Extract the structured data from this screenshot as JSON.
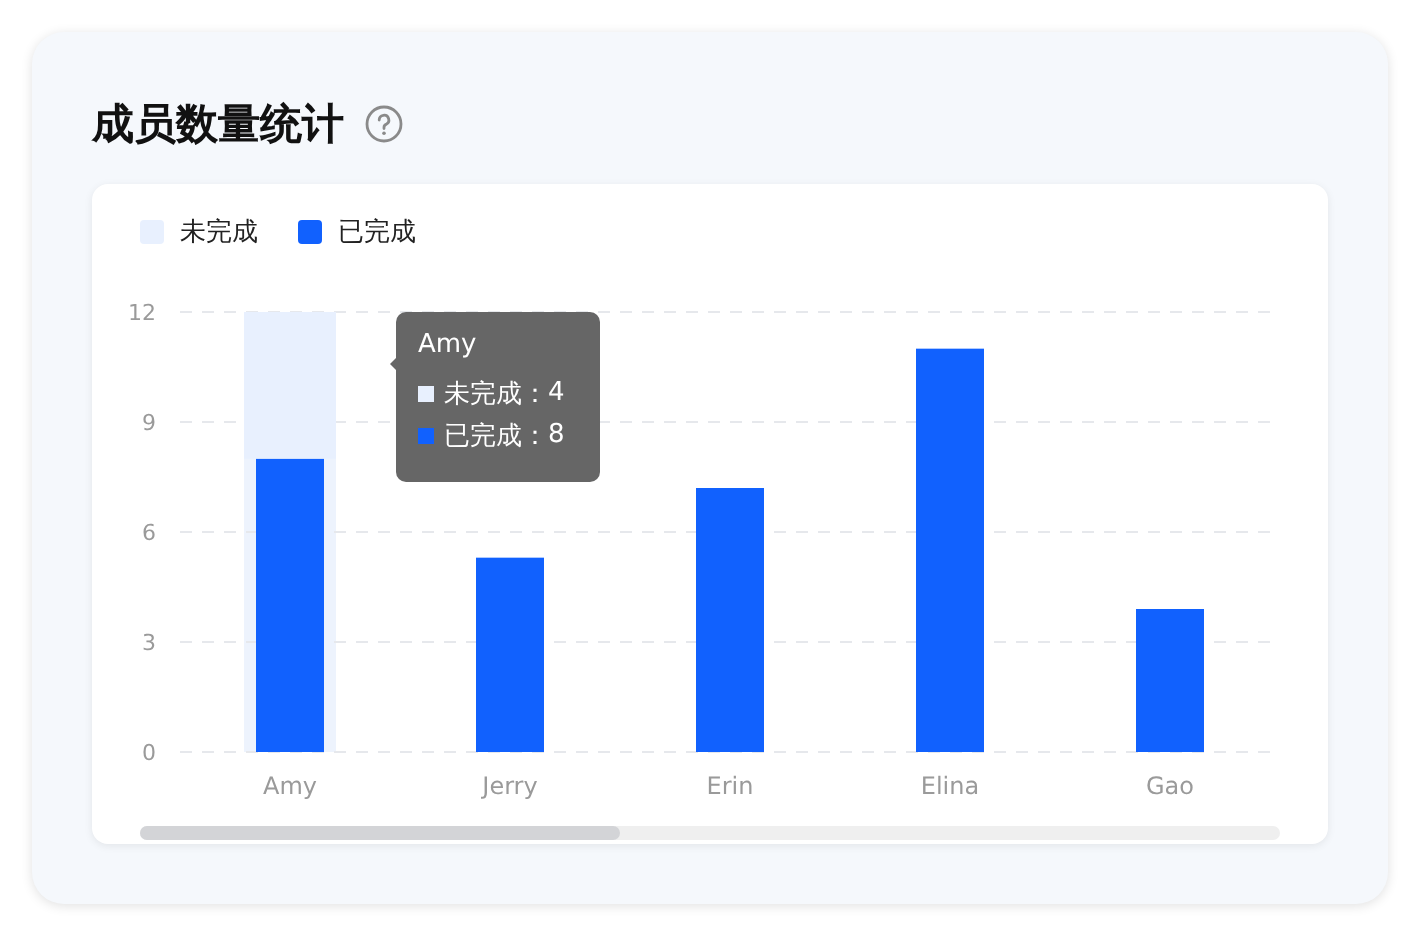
{
  "title": "成员数量统计",
  "chart_data": {
    "type": "bar",
    "stacked": true,
    "grid": true,
    "categories": [
      "Amy",
      "Jerry",
      "Erin",
      "Elina",
      "Gao"
    ],
    "ylim": [
      0,
      12
    ],
    "yticks": [
      0,
      3,
      6,
      9,
      12
    ],
    "series": [
      {
        "name": "未完成",
        "color": "#e8f0fe",
        "values": [
          4,
          null,
          null,
          null,
          null
        ]
      },
      {
        "name": "已完成",
        "color": "#1161fe",
        "values": [
          8,
          5.3,
          7.2,
          11,
          3.9
        ]
      }
    ]
  },
  "tooltip": {
    "title": "Amy",
    "rows": [
      {
        "label": "未完成：",
        "value": "4",
        "color": "#e8f0fe"
      },
      {
        "label": "已完成：",
        "value": "8",
        "color": "#1161fe"
      }
    ]
  }
}
